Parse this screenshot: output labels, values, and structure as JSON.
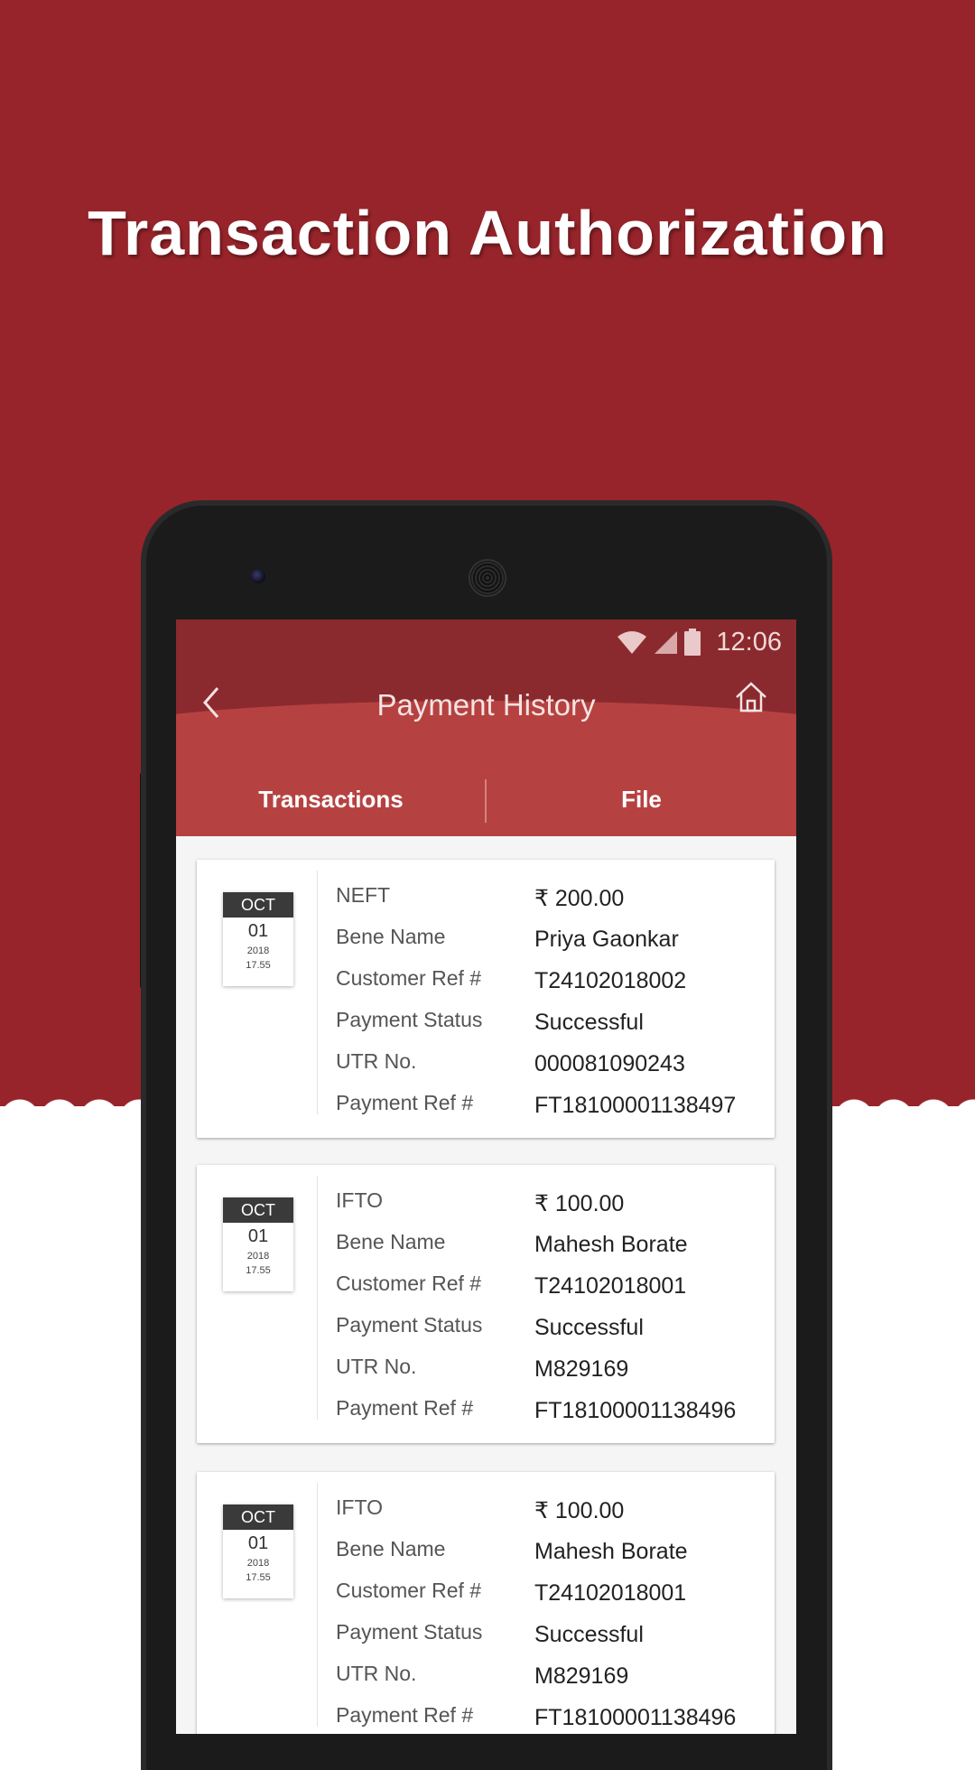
{
  "promo": {
    "title": "Transaction Authorization"
  },
  "status_bar": {
    "time": "12:06"
  },
  "app_bar": {
    "title": "Payment History"
  },
  "tabs": [
    {
      "label": "Transactions",
      "selected": true
    },
    {
      "label": "File",
      "selected": false
    }
  ],
  "colors": {
    "brand_red": "#97242b",
    "app_bar": "#8b2a2e",
    "tab_bar": "#b54241",
    "tab_indicator": "#f38a8a"
  },
  "labels": {
    "bene_name": "Bene Name",
    "customer_ref": "Customer Ref #",
    "payment_status": "Payment Status",
    "utr_no": "UTR No.",
    "payment_ref": "Payment Ref #"
  },
  "transactions": [
    {
      "month": "OCT",
      "day": "01",
      "year": "2018",
      "time": "17.55",
      "type": "NEFT",
      "amount": "₹ 200.00",
      "bene_name": "Priya Gaonkar",
      "customer_ref": "T24102018002",
      "payment_status": "Successful",
      "utr_no": "000081090243",
      "payment_ref": "FT18100001138497"
    },
    {
      "month": "OCT",
      "day": "01",
      "year": "2018",
      "time": "17.55",
      "type": "IFTO",
      "amount": "₹ 100.00",
      "bene_name": "Mahesh Borate",
      "customer_ref": "T24102018001",
      "payment_status": "Successful",
      "utr_no": "M829169",
      "payment_ref": "FT18100001138496"
    },
    {
      "month": "OCT",
      "day": "01",
      "year": "2018",
      "time": "17.55",
      "type": "IFTO",
      "amount": "₹ 100.00",
      "bene_name": "Mahesh Borate",
      "customer_ref": "T24102018001",
      "payment_status": "Successful",
      "utr_no": "M829169",
      "payment_ref": "FT18100001138496"
    }
  ]
}
